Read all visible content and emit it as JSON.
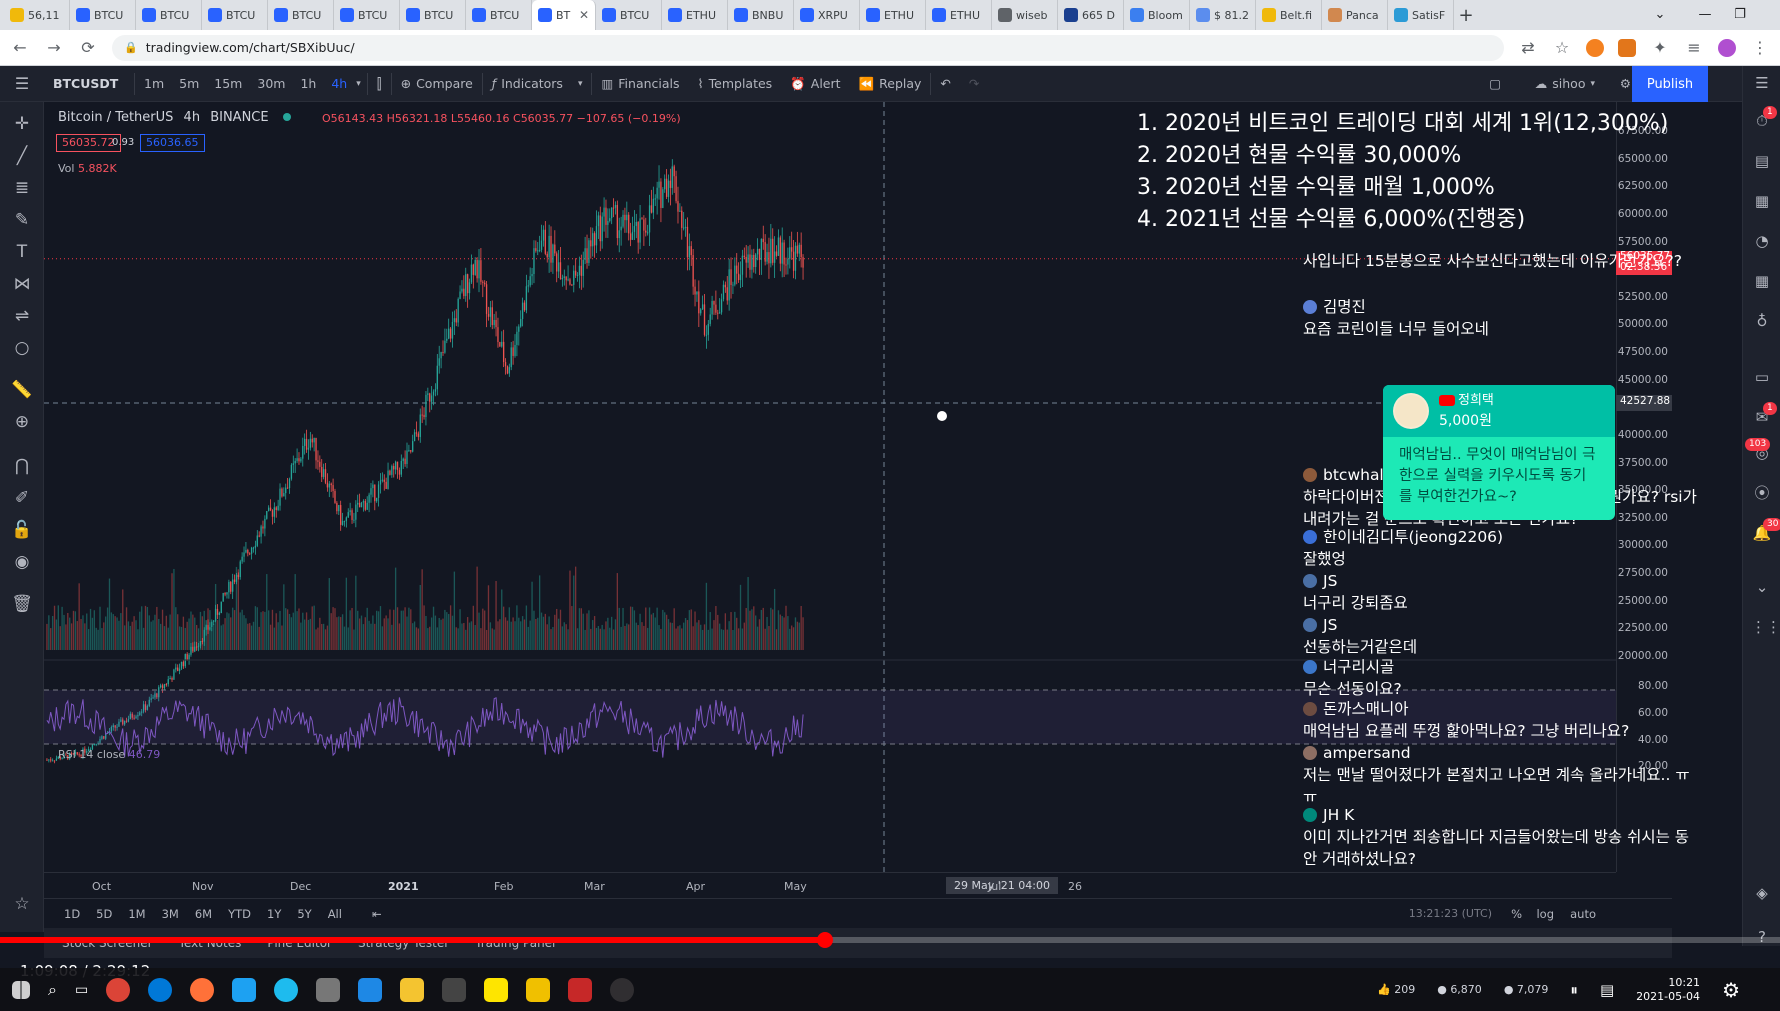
{
  "browser": {
    "tabs": [
      {
        "label": "56,11",
        "color": "#f0b90b"
      },
      {
        "label": "BTCU",
        "color": "#2962ff"
      },
      {
        "label": "BTCU",
        "color": "#2962ff"
      },
      {
        "label": "BTCU",
        "color": "#2962ff"
      },
      {
        "label": "BTCU",
        "color": "#2962ff"
      },
      {
        "label": "BTCU",
        "color": "#2962ff"
      },
      {
        "label": "BTCU",
        "color": "#2962ff"
      },
      {
        "label": "BTCU",
        "color": "#2962ff"
      },
      {
        "label": "BT",
        "color": "#2962ff",
        "active": true
      },
      {
        "label": "BTCU",
        "color": "#2962ff"
      },
      {
        "label": "ETHU",
        "color": "#2962ff"
      },
      {
        "label": "BNBU",
        "color": "#2962ff"
      },
      {
        "label": "XRPU",
        "color": "#2962ff"
      },
      {
        "label": "ETHU",
        "color": "#2962ff"
      },
      {
        "label": "ETHU",
        "color": "#2962ff"
      },
      {
        "label": "wiseb",
        "color": "#5f6368"
      },
      {
        "label": "665 D",
        "color": "#1a3f8f"
      },
      {
        "label": "Bloom",
        "color": "#3b7ff0"
      },
      {
        "label": "$ 81.2",
        "color": "#5b8dee"
      },
      {
        "label": "Belt.fi",
        "color": "#f0b90b"
      },
      {
        "label": "Panca",
        "color": "#d1884f"
      },
      {
        "label": "SatisF",
        "color": "#2c9bd6"
      }
    ],
    "url": "tradingview.com/chart/SBXibUuc/"
  },
  "toolbar": {
    "symbol": "BTCUSDT",
    "timeframes": [
      "1m",
      "5m",
      "15m",
      "30m",
      "1h",
      "4h"
    ],
    "active_timeframe": "4h",
    "compare": "Compare",
    "indicators": "Indicators",
    "financials": "Financials",
    "templates": "Templates",
    "alert": "Alert",
    "replay": "Replay",
    "user": "sihoo",
    "publish": "Publish"
  },
  "legend": {
    "title": "Bitcoin / TetherUS",
    "interval": "4h",
    "exchange": "BINANCE",
    "ohlc": "O56143.43 H56321.18 L55460.16 C56035.77 −107.65 (−0.19%)",
    "bid": "56035.72",
    "spread": "0.93",
    "ask": "56036.65",
    "vol_label": "Vol",
    "vol_value": "5.882K",
    "rsi_label": "RSI 14 close",
    "rsi_value": "46.79"
  },
  "price_axis": {
    "ticks": [
      "67500.00",
      "65000.00",
      "62500.00",
      "60000.00",
      "57500.00",
      "55000.00",
      "52500.00",
      "50000.00",
      "47500.00",
      "45000.00",
      "42500.00",
      "40000.00",
      "37500.00",
      "35000.00",
      "32500.00",
      "30000.00",
      "27500.00",
      "25000.00",
      "22500.00",
      "20000.00"
    ],
    "current_price": "56035.77",
    "countdown": "02:38:36",
    "crosshair_price": "42527.88",
    "rsi_ticks": [
      "80.00",
      "60.00",
      "40.00",
      "20.00"
    ]
  },
  "time_axis": {
    "ticks": [
      "Oct",
      "Nov",
      "Dec",
      "2021",
      "Feb",
      "Mar",
      "Apr",
      "May",
      "Jul",
      "26"
    ],
    "crosshair": "29 May '21  04:00"
  },
  "range_bar": {
    "ranges": [
      "1D",
      "5D",
      "1M",
      "3M",
      "6M",
      "YTD",
      "1Y",
      "5Y",
      "All"
    ],
    "utc": "13:21:23 (UTC)",
    "percent": "%",
    "log": "log",
    "auto": "auto"
  },
  "bottom_panel": [
    "Stock Screener",
    "Text Notes",
    "Pine Editor",
    "Strategy Tester",
    "Trading Panel"
  ],
  "achievements": [
    "1. 2020년 비트코인 트레이딩 대회 세계 1위(12,300%)",
    "2. 2020년 현물 수익률 30,000%",
    "3. 2020년 선물 수익률 매월 1,000%",
    "4. 2021년 선물 수익률 6,000%(진행중)"
  ],
  "chat": [
    {
      "name": "",
      "text": "사입니다 15분봉으로 사수보신다고했는데 이유가먼가요??",
      "color": "#000"
    },
    {
      "name": "김명진",
      "text": "요즘 코린이들 너무 들어오네",
      "color": "#5b7fd6"
    },
    {
      "name": "btcwhale _",
      "text": "하락다이버전스가 컨펌됐다고 확신하는 기준이 뭔가요? rsi가 내려가는 걸 눈으로 확인하고 보는 건가요?",
      "color": "#8d5a3b"
    },
    {
      "name": "한이네김디투(jeong2206)",
      "text": "잘했엉",
      "color": "#3a6fd8"
    },
    {
      "name": "JS",
      "text": "너구리 강퇴좀요",
      "color": "#4a6fa5"
    },
    {
      "name": "JS",
      "text": "선동하는거같은데",
      "color": "#4a6fa5"
    },
    {
      "name": "너구리시골",
      "text": "무슨 선동이요?",
      "color": "#3b76c9"
    },
    {
      "name": "돈까스매니아",
      "text": "매억남님 요플레 뚜껑 핥아먹나요? 그냥 버리나요?",
      "color": "#6d4c41"
    },
    {
      "name": "ampersand",
      "text": "저는 맨날 떨어졌다가 본절치고 나오면 계속 올라가네요.. ㅠㅠ",
      "color": "#8d6e63"
    },
    {
      "name": "JH K",
      "text": "이미 지나간거면 죄송합니다 지금들어왔는데 방송 쉬시는 동안 거래하셨나요?",
      "color": "#00897b"
    }
  ],
  "superchat": {
    "name": "정희택",
    "amount": "5,000원",
    "text": "매억남님.. 무엇이 매억남님이 극한으로 실력을 키우시도록 동기를 부여한건가요~?"
  },
  "video": {
    "current": "1:09:08",
    "total": "2:29:12",
    "progress": 0.4635
  },
  "tray": {
    "time": "10:21",
    "date": "2021-05-04",
    "likes": "209",
    "stat1": "6,870",
    "stat2": "7,079"
  },
  "right_badges": [
    "1",
    "1",
    "103",
    "30"
  ],
  "chart_data": {
    "type": "candlestick",
    "symbol": "BTCUSDT",
    "interval": "4h",
    "x": [
      "Oct",
      "Nov",
      "Dec",
      "2021",
      "Feb",
      "Mar",
      "Apr",
      "May"
    ],
    "y_close_path": [
      10700,
      11200,
      13500,
      15500,
      19000,
      23000,
      29000,
      34000,
      40000,
      32000,
      35000,
      38000,
      47000,
      56000,
      46000,
      58000,
      54000,
      60000,
      58000,
      64000,
      50000,
      55000,
      57000,
      56035.77
    ],
    "ylim": [
      20000,
      67500
    ],
    "last_close": 56035.77,
    "rsi_levels": [
      30,
      70
    ]
  }
}
